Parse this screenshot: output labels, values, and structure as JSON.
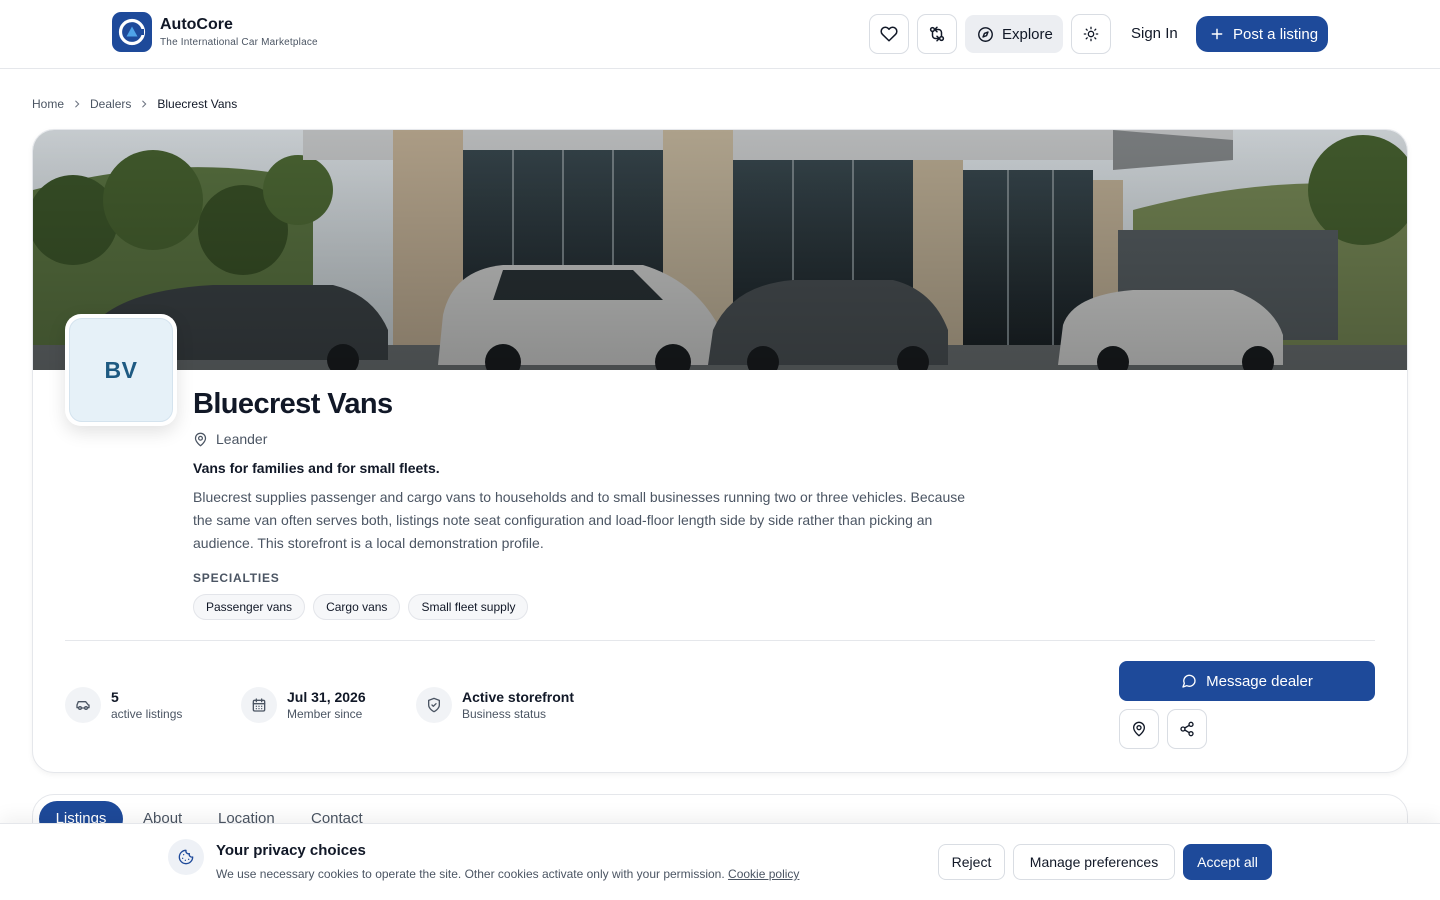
{
  "header": {
    "brand_name": "AutoCore",
    "brand_tagline": "The International Car Marketplace",
    "explore_label": "Explore",
    "signin_label": "Sign In",
    "post_label": "Post a listing"
  },
  "breadcrumb": [
    "Home",
    "Dealers",
    "Bluecrest Vans"
  ],
  "dealer": {
    "initials": "BV",
    "name": "Bluecrest Vans",
    "location": "Leander",
    "tagline": "Vans for families and for small fleets.",
    "description": "Bluecrest supplies passenger and cargo vans to households and to small businesses running two or three vehicles. Because the same van often serves both, listings note seat configuration and load-floor length side by side rather than picking an audience. This storefront is a local demonstration profile.",
    "specialties_label": "SPECIALTIES",
    "specialties": [
      "Passenger vans",
      "Cargo vans",
      "Small fleet supply"
    ]
  },
  "stats": [
    {
      "value": "5",
      "label": "active listings",
      "icon": "car-icon"
    },
    {
      "value": "Jul 31, 2026",
      "label": "Member since",
      "icon": "calendar-icon"
    },
    {
      "value": "Active storefront",
      "label": "Business status",
      "icon": "shield-check-icon"
    }
  ],
  "actions": {
    "message_label": "Message dealer"
  },
  "tabs": [
    "Listings",
    "About",
    "Location",
    "Contact"
  ],
  "cookie": {
    "title": "Your privacy choices",
    "text": "We use necessary cookies to operate the site. Other cookies activate only with your permission.",
    "link": "Cookie policy",
    "reject": "Reject",
    "manage": "Manage preferences",
    "accept": "Accept all"
  },
  "colors": {
    "brand": "#1e4a9a",
    "avatar_bg": "#e6f1f8",
    "avatar_text": "#1e5a82"
  }
}
